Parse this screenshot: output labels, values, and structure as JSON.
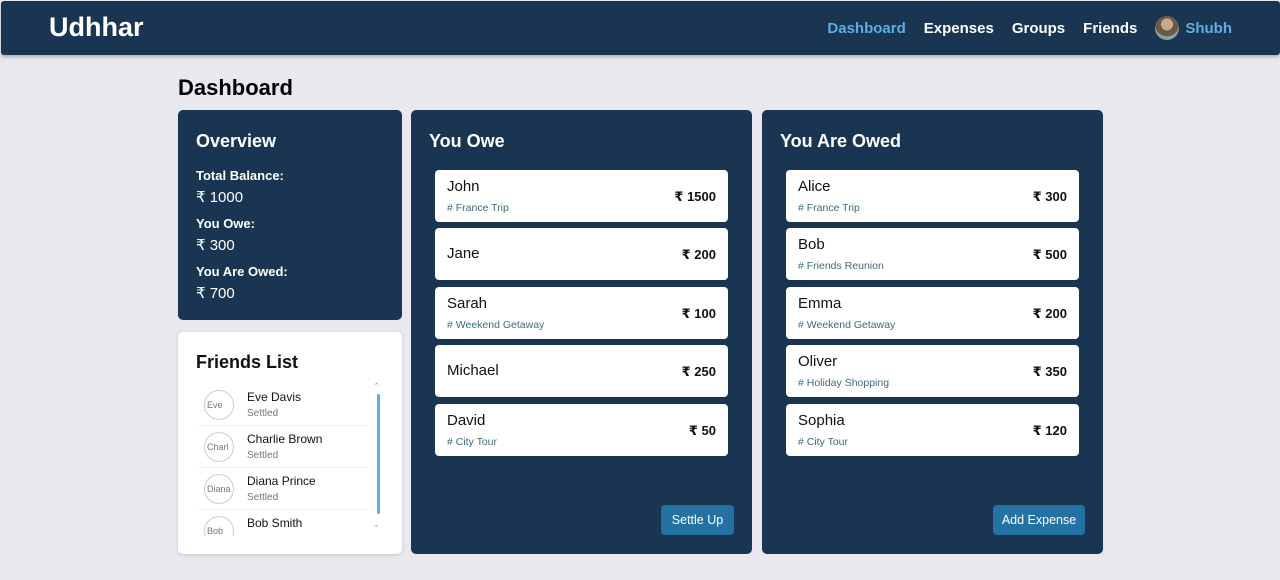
{
  "nav": {
    "brand": "Udhhar",
    "links": [
      {
        "label": "Dashboard",
        "active": true
      },
      {
        "label": "Expenses",
        "active": false
      },
      {
        "label": "Groups",
        "active": false
      },
      {
        "label": "Friends",
        "active": false
      }
    ],
    "user_name": "Shubh"
  },
  "page_title": "Dashboard",
  "overview": {
    "title": "Overview",
    "total_balance_label": "Total Balance:",
    "total_balance_value": "₹ 1000",
    "you_owe_label": "You Owe:",
    "you_owe_value": "₹ 300",
    "you_are_owed_label": "You Are Owed:",
    "you_are_owed_value": "₹ 700"
  },
  "friends_list": {
    "title": "Friends List",
    "items": [
      {
        "name": "Eve Davis",
        "status": "Settled",
        "avatar_alt": "Eve"
      },
      {
        "name": "Charlie Brown",
        "status": "Settled",
        "avatar_alt": "Charl"
      },
      {
        "name": "Diana Prince",
        "status": "Settled",
        "avatar_alt": "Diana"
      },
      {
        "name": "Bob Smith",
        "status": "",
        "avatar_alt": "Bob"
      }
    ]
  },
  "you_owe": {
    "title": "You Owe",
    "items": [
      {
        "name": "John",
        "tag": "# France Trip",
        "amount": "₹ 1500"
      },
      {
        "name": "Jane",
        "tag": "",
        "amount": "₹ 200"
      },
      {
        "name": "Sarah",
        "tag": "# Weekend Getaway",
        "amount": "₹ 100"
      },
      {
        "name": "Michael",
        "tag": "",
        "amount": "₹ 250"
      },
      {
        "name": "David",
        "tag": "# City Tour",
        "amount": "₹ 50"
      }
    ],
    "button_label": "Settle Up"
  },
  "you_are_owed": {
    "title": "You Are Owed",
    "items": [
      {
        "name": "Alice",
        "tag": "# France Trip",
        "amount": "₹ 300"
      },
      {
        "name": "Bob",
        "tag": "# Friends Reunion",
        "amount": "₹ 500"
      },
      {
        "name": "Emma",
        "tag": "# Weekend Getaway",
        "amount": "₹ 200"
      },
      {
        "name": "Oliver",
        "tag": "# Holiday Shopping",
        "amount": "₹ 350"
      },
      {
        "name": "Sophia",
        "tag": "# City Tour",
        "amount": "₹ 120"
      }
    ],
    "button_label": "Add Expense"
  }
}
